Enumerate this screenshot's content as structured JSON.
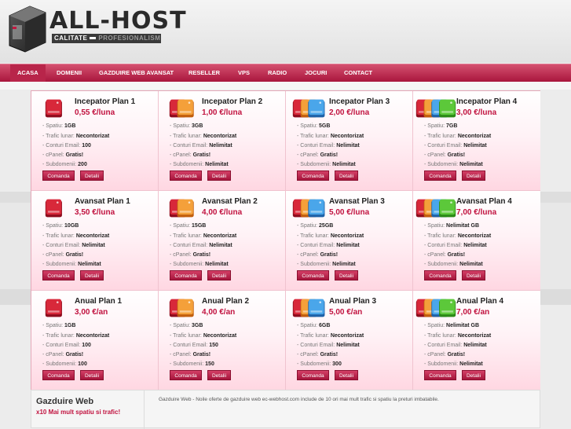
{
  "header": {
    "logo_title": "ALL-HOST",
    "tagline_a": "CALITATE",
    "tagline_b": "PROFESIONALISM"
  },
  "nav": [
    "ACASA",
    "DOMENII",
    "GAZDUIRE WEB AVANSAT",
    "RESELLER",
    "VPS",
    "RADIO",
    "JOCURI",
    "CONTACT"
  ],
  "labels": {
    "spatiu": "- Spatiu:",
    "trafic": "- Trafic lunar:",
    "email": "- Conturi Email:",
    "cpanel": "- cPanel:",
    "subdomenii": "- Subdomenii:",
    "comanda": "Comanda",
    "detalii": "Detalii"
  },
  "plans": [
    {
      "name": "Incepator Plan 1",
      "price": "0,55 €/luna",
      "spatiu": "1GB",
      "trafic": "Necontorizat",
      "email": "100",
      "cpanel": "Gratis!",
      "subdomenii": "200",
      "icon": "server-drive-red"
    },
    {
      "name": "Incepator Plan 2",
      "price": "1,00 €/luna",
      "spatiu": "3GB",
      "trafic": "Necontorizat",
      "email": "Nelimitat",
      "cpanel": "Gratis!",
      "subdomenii": "Nelimitat",
      "icon": "server-drive-orange"
    },
    {
      "name": "Incepator Plan 3",
      "price": "2,00 €/luna",
      "spatiu": "5GB",
      "trafic": "Necontorizat",
      "email": "Nelimitat",
      "cpanel": "Gratis!",
      "subdomenii": "Nelimitat",
      "icon": "server-drive-blue"
    },
    {
      "name": "Incepator Plan 4",
      "price": "3,00 €/luna",
      "spatiu": "7GB",
      "trafic": "Necontorizat",
      "email": "Nelimitat",
      "cpanel": "Gratis!",
      "subdomenii": "Nelimitat",
      "icon": "server-drive-green"
    },
    {
      "name": "Avansat Plan 1",
      "price": "3,50 €/luna",
      "spatiu": "10GB",
      "trafic": "Necontorizat",
      "email": "Nelimitat",
      "cpanel": "Gratis!",
      "subdomenii": "Nelimitat",
      "icon": "server-drive-red"
    },
    {
      "name": "Avansat Plan 2",
      "price": "4,00 €/luna",
      "spatiu": "15GB",
      "trafic": "Necontorizat",
      "email": "Nelimitat",
      "cpanel": "Gratis!",
      "subdomenii": "Nelimitat",
      "icon": "server-drive-orange"
    },
    {
      "name": "Avansat Plan 3",
      "price": "5,00 €/luna",
      "spatiu": "25GB",
      "trafic": "Necontorizat",
      "email": "Nelimitat",
      "cpanel": "Gratis!",
      "subdomenii": "Nelimitat",
      "icon": "server-drive-blue"
    },
    {
      "name": "Avansat Plan 4",
      "price": "7,00 €/luna",
      "spatiu": "Nelimitat GB",
      "trafic": "Necontorizat",
      "email": "Nelimitat",
      "cpanel": "Gratis!",
      "subdomenii": "Nelimitat",
      "icon": "server-drive-green"
    },
    {
      "name": "Anual Plan 1",
      "price": "3,00 €/an",
      "spatiu": "1GB",
      "trafic": "Necontorizat",
      "email": "100",
      "cpanel": "Gratis!",
      "subdomenii": "100",
      "icon": "server-drive-red"
    },
    {
      "name": "Anual Plan 2",
      "price": "4,00 €/an",
      "spatiu": "3GB",
      "trafic": "Necontorizat",
      "email": "150",
      "cpanel": "Gratis!",
      "subdomenii": "150",
      "icon": "server-drive-orange"
    },
    {
      "name": "Anual Plan 3",
      "price": "5,00 €/an",
      "spatiu": "6GB",
      "trafic": "Necontorizat",
      "email": "Nelimitat",
      "cpanel": "Gratis!",
      "subdomenii": "300",
      "icon": "server-drive-blue"
    },
    {
      "name": "Anual Plan 4",
      "price": "7,00 €/an",
      "spatiu": "Nelimitat GB",
      "trafic": "Necontorizat",
      "email": "Nelimitat",
      "cpanel": "Gratis!",
      "subdomenii": "Nelimitat",
      "icon": "server-drive-green"
    }
  ],
  "bottom": {
    "title": "Gazduire Web",
    "subtitle": "x10 Mai mult spatiu si trafic!",
    "description": "Gazduire Web - Noile oferte de gazduire web ec-webhost.com include de 10 ori mai mult trafic si spatiu la preturi imbatabile."
  },
  "colors": {
    "accent": "#b8254a",
    "price": "#c1123f"
  }
}
